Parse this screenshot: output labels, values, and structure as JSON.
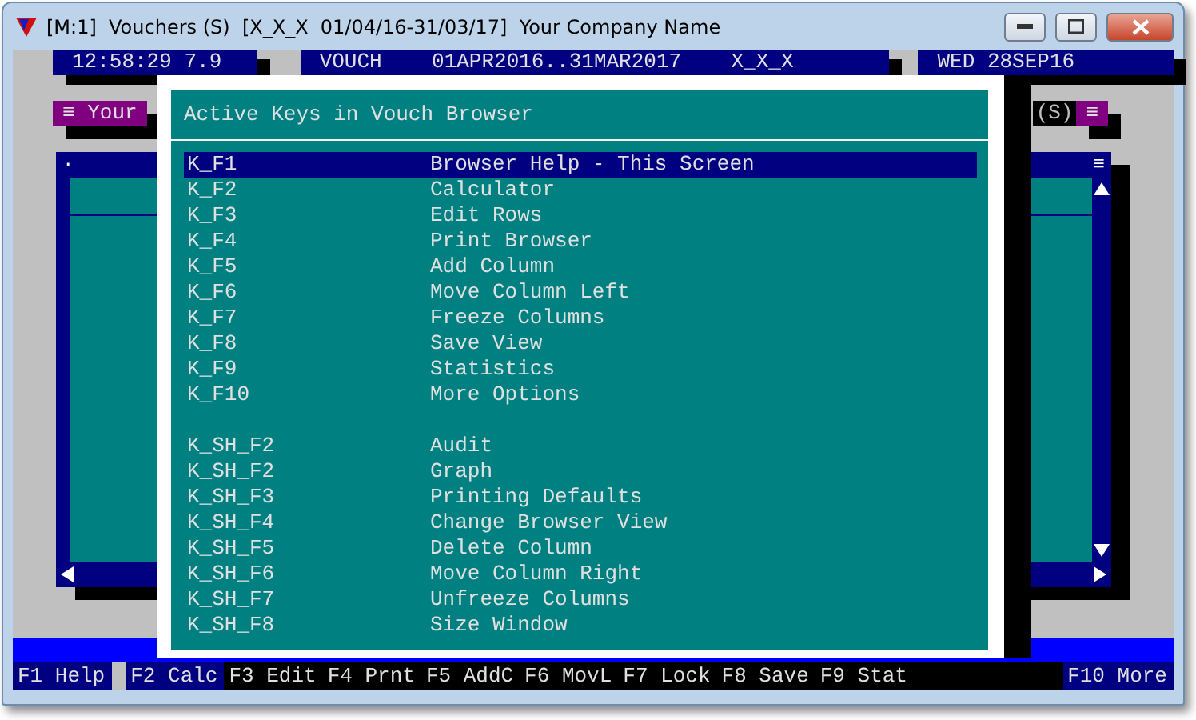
{
  "window": {
    "title": "[M:1]  Vouchers (S)  [X_X_X  01/04/16-31/03/17]  Your Company Name"
  },
  "status_bar": [
    {
      "text": "12:58:29 7.9"
    },
    {
      "text": "VOUCH    01APR2016..31MAR2017    X_X_X"
    },
    {
      "text": "WED 28SEP16"
    }
  ],
  "browser_window": {
    "title_left": "≡ Your",
    "title_right_suffix": "(S)",
    "title_right_menu": "≡",
    "corner_mark": "·",
    "menu_mark": "≡"
  },
  "dialog": {
    "title": "Active Keys in Vouch Browser",
    "groups": [
      [
        {
          "key": "K_F1",
          "action": "Browser Help - This Screen",
          "selected": true
        },
        {
          "key": "K_F2",
          "action": "Calculator",
          "selected": false
        },
        {
          "key": "K_F3",
          "action": "Edit Rows",
          "selected": false
        },
        {
          "key": "K_F4",
          "action": "Print Browser",
          "selected": false
        },
        {
          "key": "K_F5",
          "action": "Add Column",
          "selected": false
        },
        {
          "key": "K_F6",
          "action": "Move Column Left",
          "selected": false
        },
        {
          "key": "K_F7",
          "action": "Freeze Columns",
          "selected": false
        },
        {
          "key": "K_F8",
          "action": "Save View",
          "selected": false
        },
        {
          "key": "K_F9",
          "action": "Statistics",
          "selected": false
        },
        {
          "key": "K_F10",
          "action": "More Options",
          "selected": false
        }
      ],
      [
        {
          "key": "K_SH_F2",
          "action": "Audit",
          "selected": false
        },
        {
          "key": "K_SH_F2",
          "action": "Graph",
          "selected": false
        },
        {
          "key": "K_SH_F3",
          "action": "Printing Defaults",
          "selected": false
        },
        {
          "key": "K_SH_F4",
          "action": "Change Browser View",
          "selected": false
        },
        {
          "key": "K_SH_F5",
          "action": "Delete Column",
          "selected": false
        },
        {
          "key": "K_SH_F6",
          "action": "Move Column Right",
          "selected": false
        },
        {
          "key": "K_SH_F7",
          "action": "Unfreeze Columns",
          "selected": false
        },
        {
          "key": "K_SH_F8",
          "action": "Size Window",
          "selected": false
        }
      ]
    ]
  },
  "function_keys": [
    {
      "label": "F1 Help",
      "color": "#000080"
    },
    {
      "label": "F2 Calc",
      "color": "#000080"
    },
    {
      "label": "F3 Edit",
      "color": "#000000"
    },
    {
      "label": "F4 Prnt",
      "color": "#000000"
    },
    {
      "label": "F5 AddC",
      "color": "#000000"
    },
    {
      "label": "F6 MovL",
      "color": "#000000"
    },
    {
      "label": "F7 Lock",
      "color": "#000000"
    },
    {
      "label": "F8 Save",
      "color": "#000000"
    },
    {
      "label": "F9 Stat",
      "color": "#000000"
    },
    {
      "label": "F10 More",
      "color": "#000080"
    }
  ]
}
